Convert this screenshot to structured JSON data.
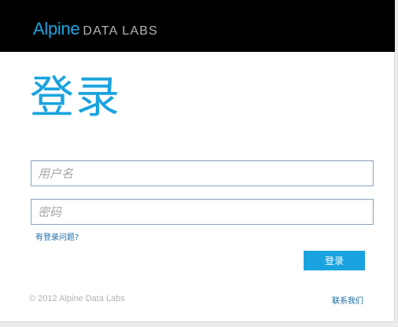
{
  "header": {
    "brand": "Alpine",
    "brand_suffix": "DATA LABS"
  },
  "login": {
    "title": "登录",
    "username_placeholder": "用户名",
    "password_placeholder": "密码",
    "problem_link": "有登录问题?",
    "submit_label": "登录"
  },
  "footer": {
    "copyright": "© 2012 Alpine Data Labs",
    "contact_link": "联系我们"
  },
  "colors": {
    "accent": "#1aa3df",
    "header_bg": "#000000",
    "link": "#1a6aa6"
  }
}
